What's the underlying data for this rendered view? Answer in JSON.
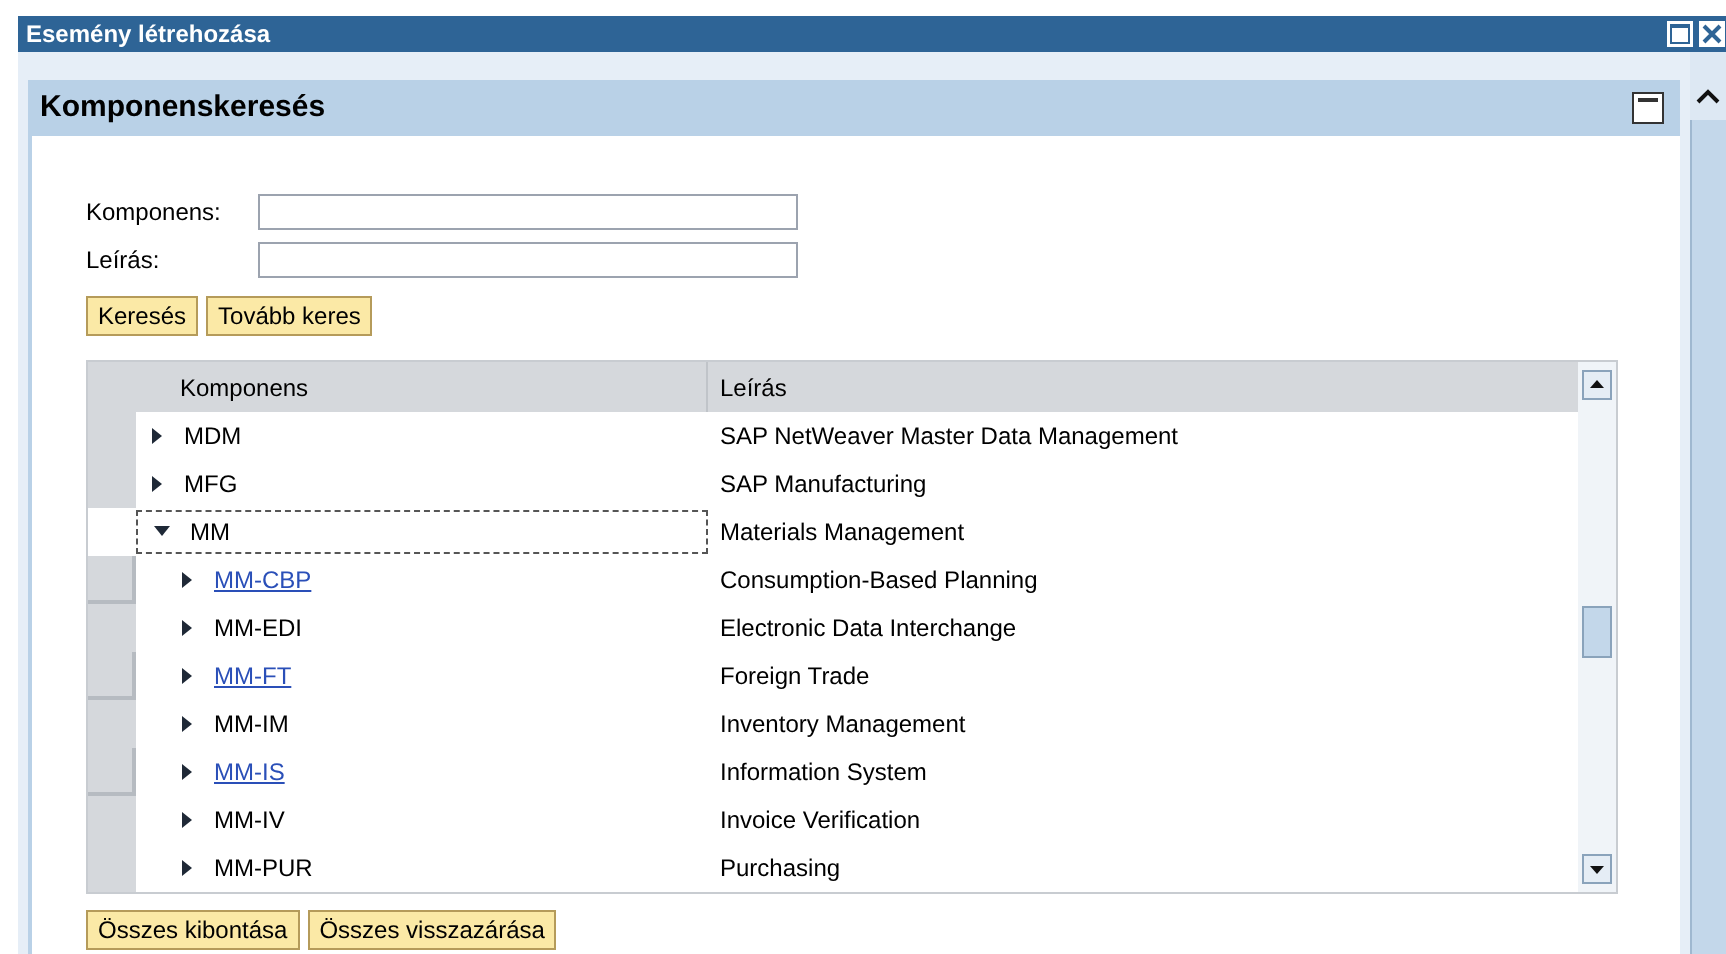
{
  "window": {
    "title": "Esemény létrehozása"
  },
  "panel": {
    "title": "Komponenskeresés",
    "fields": [
      {
        "label": "Komponens:"
      },
      {
        "label": "Leírás:"
      }
    ],
    "search_buttons": [
      "Keresés",
      "Tovább keres"
    ],
    "table": {
      "columns": [
        "Komponens",
        "Leírás"
      ],
      "rows": [
        {
          "component": "MDM",
          "description": "SAP NetWeaver Master Data Management",
          "expanded": false,
          "link": false,
          "focused": false
        },
        {
          "component": "MFG",
          "description": "SAP Manufacturing",
          "expanded": false,
          "link": false,
          "focused": false
        },
        {
          "component": "MM",
          "description": "Materials Management",
          "expanded": true,
          "link": false,
          "focused": true,
          "children": [
            {
              "component": "MM-CBP",
              "description": "Consumption-Based Planning",
              "expanded": false,
              "link": true,
              "focused": false
            },
            {
              "component": "MM-EDI",
              "description": "Electronic Data Interchange",
              "expanded": false,
              "link": false,
              "focused": false
            },
            {
              "component": "MM-FT",
              "description": "Foreign Trade",
              "expanded": false,
              "link": true,
              "focused": false
            },
            {
              "component": "MM-IM",
              "description": "Inventory Management",
              "expanded": false,
              "link": false,
              "focused": false
            },
            {
              "component": "MM-IS",
              "description": "Information System",
              "expanded": false,
              "link": true,
              "focused": false
            },
            {
              "component": "MM-IV",
              "description": "Invoice Verification",
              "expanded": false,
              "link": false,
              "focused": false
            },
            {
              "component": "MM-PUR",
              "description": "Purchasing",
              "expanded": false,
              "link": false,
              "focused": false
            }
          ]
        }
      ]
    },
    "tree_buttons": [
      "Összes kibontása",
      "Összes visszazárása"
    ]
  }
}
